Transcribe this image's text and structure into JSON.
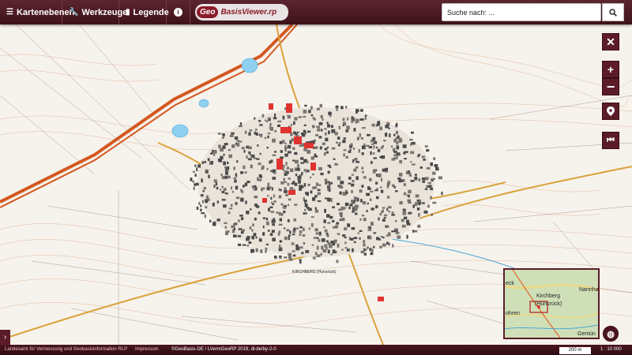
{
  "toolbar": {
    "layers_label": "Kartenebenen",
    "tools_label": "Werkzeuge",
    "legend_label": "Legende",
    "info_label": "i"
  },
  "logo": {
    "geo": "Geo",
    "rest": "BasisViewer.rp"
  },
  "search": {
    "placeholder": "Suche nach: ..."
  },
  "overview": {
    "labels": [
      "Kirchberg",
      "(Hunsrück)",
      "Nannha",
      "eck",
      "Gemün",
      "ohren"
    ]
  },
  "footer": {
    "lvg": "Landesamt für Vermessung und Geobasisinformation RLP",
    "impressum": "Impressum",
    "copyright": "©GeoBasis-DE / LVermGeoRP 2019, dl-de/by-2-0",
    "scalebar": "200 m",
    "scale": "1 : 10 000"
  },
  "map": {
    "place_label": "KIRCHBERG (Hunsrück)"
  },
  "colors": {
    "accent": "#5b1c28",
    "topbar": "#4a1722",
    "building_red": "#e0332f",
    "highway": "#d4571f",
    "water": "#8fd0f0"
  }
}
